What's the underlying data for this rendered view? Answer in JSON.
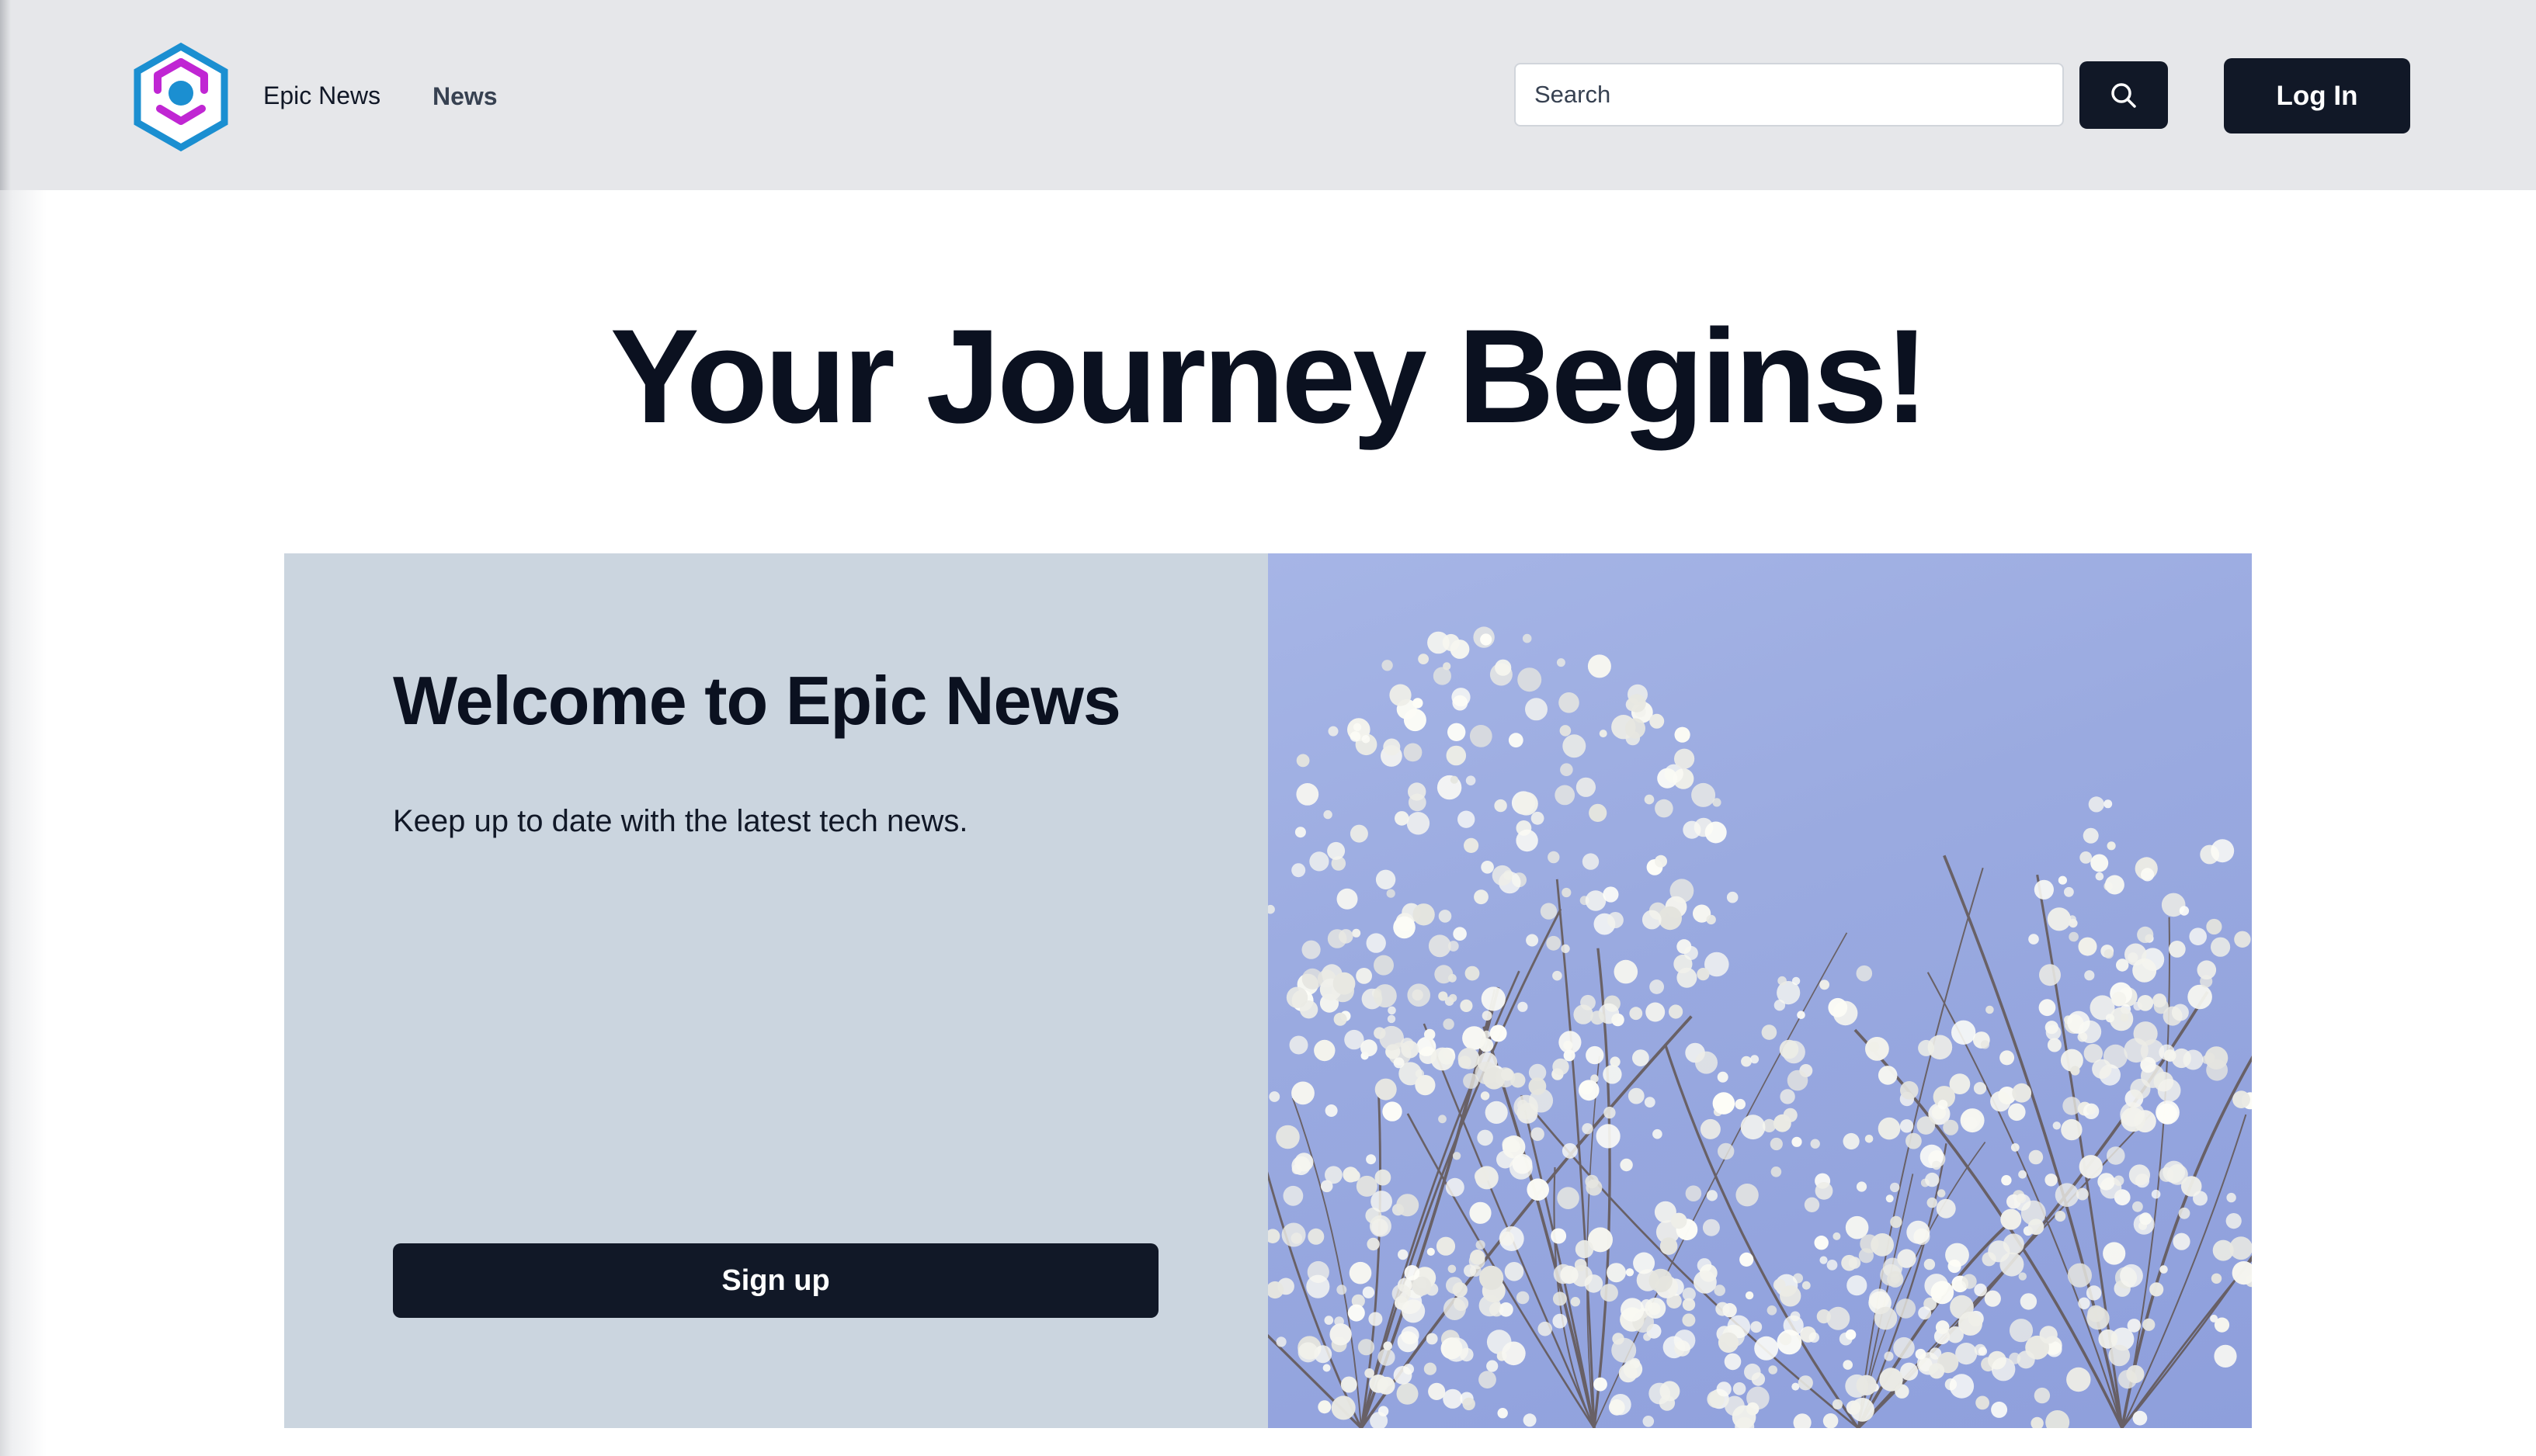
{
  "header": {
    "brand": "Epic News",
    "nav": [
      {
        "label": "News"
      }
    ],
    "search": {
      "placeholder": "Search",
      "icon": "search-icon"
    },
    "login_label": "Log In"
  },
  "main": {
    "title": "Your Journey Begins!",
    "hero": {
      "heading": "Welcome to Epic News",
      "subtext": "Keep up to date with the latest tech news.",
      "signup_label": "Sign up",
      "image": "white-blossom-tree-against-blue-sky"
    }
  },
  "colors": {
    "header_bg": "#e6e7ea",
    "button_dark": "#111827",
    "hero_panel": "#cbd5df",
    "sky": "#9aaae0",
    "logo_blue": "#1b8fd1",
    "logo_magenta": "#c026d3"
  }
}
